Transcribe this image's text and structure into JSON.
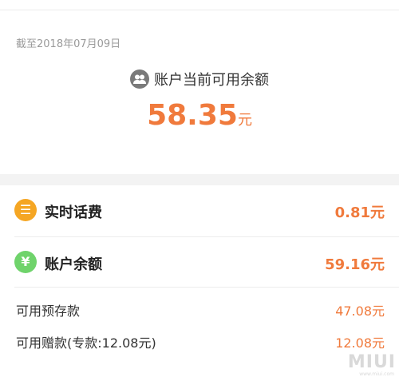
{
  "header": {
    "date_text": "截至2018年07月09日",
    "balance_label": "账户当前可用余额",
    "balance_value": "58.35",
    "balance_unit": "元"
  },
  "rows": {
    "realtime_fee": {
      "icon": "list-icon",
      "icon_glyph": "☰",
      "icon_color": "#f5a623",
      "label": "实时话费",
      "value": "0.81元"
    },
    "account_balance": {
      "icon": "yen-icon",
      "icon_glyph": "¥",
      "icon_color": "#6fd36b",
      "label": "账户余额",
      "value": "59.16元"
    },
    "prepaid": {
      "label": "可用预存款",
      "value": "47.08元"
    },
    "gift": {
      "label": "可用赠款(专款:12.08元)",
      "value": "12.08元"
    }
  },
  "colors": {
    "accent": "#f07a3c",
    "text_primary": "#222222",
    "text_secondary": "#9a9a9a",
    "divider": "#ececec",
    "band": "#f3f3f3"
  },
  "watermark": {
    "brand": "MIUI",
    "sub": "www.miui.com"
  }
}
